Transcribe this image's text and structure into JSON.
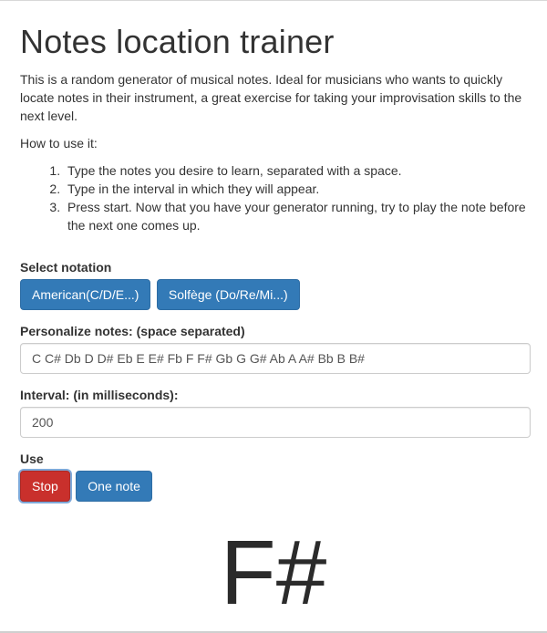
{
  "page": {
    "title": "Notes location trainer",
    "intro": "This is a random generator of musical notes. Ideal for musicians who wants to quickly locate notes in their instrument, a great exercise for taking your improvisation skills to the next level.",
    "how_to_heading": "How to use it:",
    "steps": [
      "Type the notes you desire to learn, separated with a space.",
      "Type in the interval in which they will appear.",
      "Press start. Now that you have your generator running, try to play the note before the next one comes up."
    ]
  },
  "notation": {
    "label": "Select notation",
    "american_label": "American(C/D/E...)",
    "solfege_label": "Solfège (Do/Re/Mi...)"
  },
  "notes": {
    "label": "Personalize notes: (space separated)",
    "value": "C C# Db D D# Eb E E# Fb F F# Gb G G# Ab A A# Bb B B#"
  },
  "interval": {
    "label": "Interval: (in milliseconds):",
    "value": "200"
  },
  "use": {
    "label": "Use",
    "stop_label": "Stop",
    "one_note_label": "One note"
  },
  "display": {
    "current_note": "F#"
  },
  "colors": {
    "primary": "#337ab7",
    "danger": "#c9302c"
  }
}
